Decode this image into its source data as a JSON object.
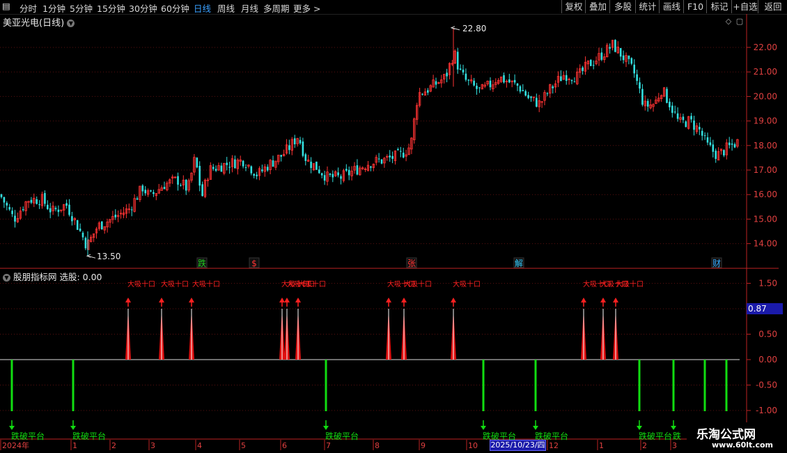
{
  "toolbar": {
    "periods": [
      "分时",
      "1分钟",
      "5分钟",
      "15分钟",
      "30分钟",
      "60分钟",
      "日线",
      "周线",
      "月线",
      "多周期",
      "更多 >"
    ],
    "active_period": "日线",
    "tools": [
      "复权",
      "叠加",
      "多股",
      "统计",
      "画线",
      "F10",
      "标记",
      "+自选",
      "返回"
    ]
  },
  "main_chart": {
    "title": "美亚光电(日线)",
    "high_label": "22.80",
    "low_label": "13.50",
    "y_ticks": [
      "22.00",
      "21.00",
      "20.00",
      "19.00",
      "18.00",
      "17.00",
      "16.00",
      "15.00",
      "14.00"
    ],
    "markers": [
      {
        "text": "跌",
        "color": "#22cc22"
      },
      {
        "text": "$",
        "color": "#ff3333"
      },
      {
        "text": "张",
        "color": "#ff3333"
      },
      {
        "text": "解",
        "color": "#33ccff"
      },
      {
        "text": "财",
        "color": "#33aaff"
      }
    ],
    "up_color": "#ff3333",
    "down_color": "#33e0e0"
  },
  "indicator": {
    "title": "股朋指标网",
    "select_label": "选股: 0.00",
    "value_label": "0.87",
    "y_ticks": [
      "1.50",
      "1.00",
      "0.50",
      "0.00",
      "-0.50",
      "-1.00"
    ],
    "signal_label": "大吸十口",
    "breakdown_label": "跌破平台",
    "breakdown_label_last": "跌"
  },
  "time_axis": {
    "labels": [
      "2024年",
      "1",
      "2",
      "3",
      "4",
      "5",
      "6",
      "7",
      "8",
      "9",
      "10",
      "12",
      "1",
      "2",
      "3"
    ],
    "cursor_date": "2025/10/23/四"
  },
  "watermark": {
    "title": "乐淘公式网",
    "url": "www.60lt.com"
  }
}
